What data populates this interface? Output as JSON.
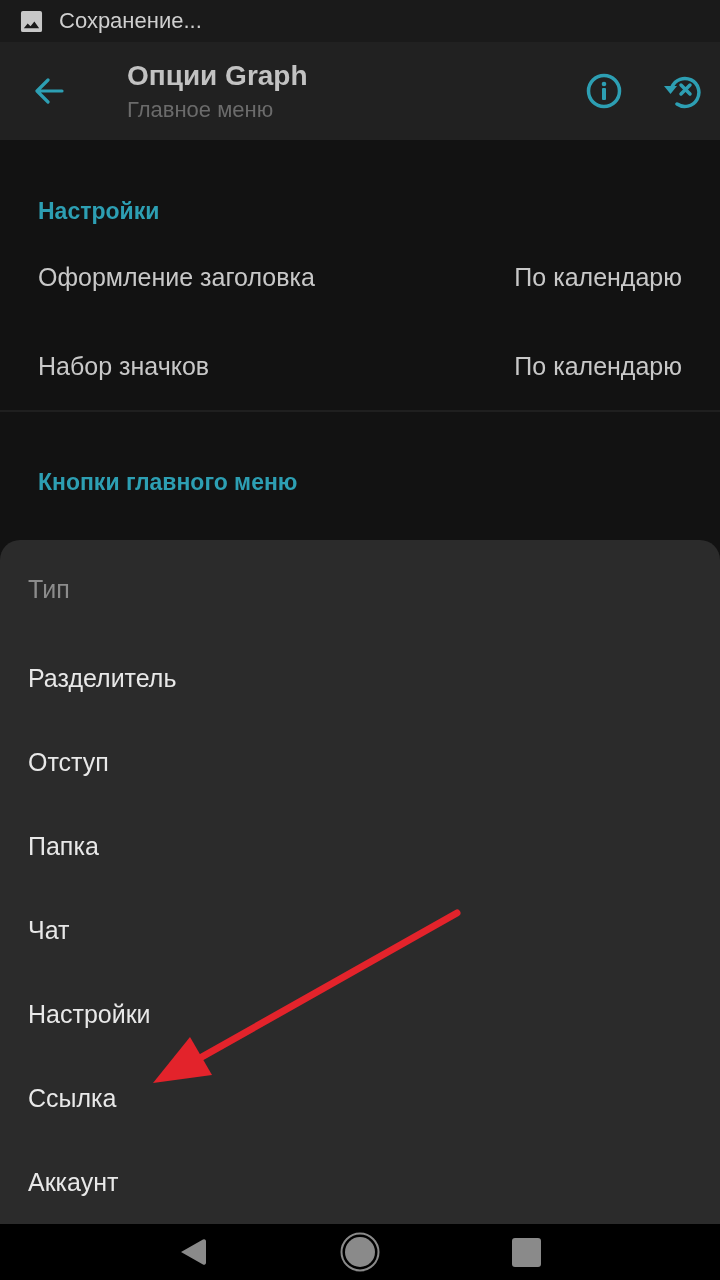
{
  "status_bar": {
    "notification": "Сохранение..."
  },
  "toolbar": {
    "title": "Опции Graph",
    "subtitle": "Главное меню"
  },
  "sections": [
    {
      "header": "Настройки",
      "rows": [
        {
          "label": "Оформление заголовка",
          "value": "По календарю"
        },
        {
          "label": "Набор значков",
          "value": "По календарю"
        }
      ]
    },
    {
      "header": "Кнопки главного меню"
    }
  ],
  "sheet": {
    "title": "Тип",
    "items": [
      "Разделитель",
      "Отступ",
      "Папка",
      "Чат",
      "Настройки",
      "Ссылка",
      "Аккаунт"
    ]
  }
}
